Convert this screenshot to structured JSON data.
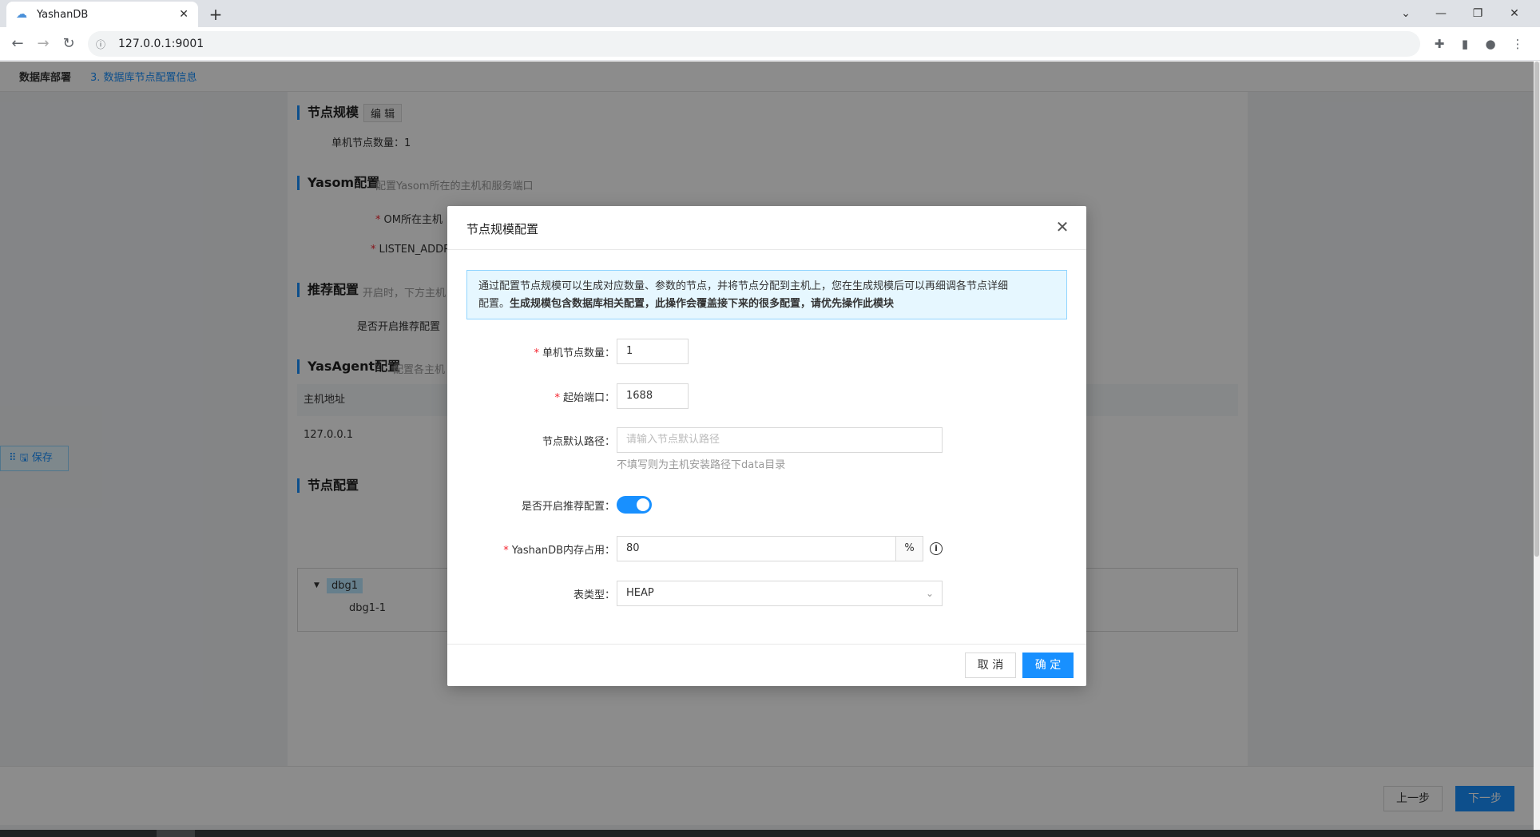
{
  "browser": {
    "tab_title": "YashanDB",
    "url": "127.0.0.1:9001",
    "icons": [
      "favicon-icon",
      "close-icon",
      "plus-icon",
      "back-icon",
      "forward-icon",
      "reload-icon",
      "info-icon",
      "extension-icon",
      "sidepanel-icon",
      "profile-icon",
      "menu-icon"
    ]
  },
  "header": {
    "crumb_main": "数据库部署",
    "crumb_step": "3. 数据库节点配置信息"
  },
  "page": {
    "node_scale": {
      "title": "节点规模",
      "edit_label": "编 辑",
      "count_label": "单机节点数量：1"
    },
    "yasom": {
      "title": "Yasom配置",
      "subtitle": "配置Yasom所在的主机和服务端口",
      "om_host_label": "OM所在主机",
      "listen_label": "LISTEN_ADDR"
    },
    "recommend": {
      "title": "推荐配置",
      "subtitle": "开启时，下方主机",
      "enable_label": "是否开启推荐配置"
    },
    "yasagent": {
      "title": "YasAgent配置",
      "subtitle": "配置各主机",
      "col_host": "主机地址",
      "host_value": "127.0.0.1"
    },
    "node_config": {
      "title": "节点配置",
      "tree_root": "dbg1",
      "tree_child": "dbg1-1"
    },
    "save_label": "保存"
  },
  "footer": {
    "prev_label": "上一步",
    "next_label": "下一步"
  },
  "modal": {
    "title": "节点规模配置",
    "notice_line1": "通过配置节点规模可以生成对应数量、参数的节点，并将节点分配到主机上，您在生成规模后可以再细调各节点详细",
    "notice_line2_prefix": "配置。",
    "notice_line2_bold": "生成规模包含数据库相关配置，此操作会覆盖接下来的很多配置，请优先操作此模块",
    "fields": {
      "node_count": {
        "label": "单机节点数量：",
        "value": "1"
      },
      "start_port": {
        "label": "起始端口：",
        "value": "1688"
      },
      "default_path": {
        "label": "节点默认路径：",
        "placeholder": "请输入节点默认路径",
        "hint": "不填写则为主机安装路径下data目录"
      },
      "recommend": {
        "label": "是否开启推荐配置：",
        "on": true
      },
      "memory": {
        "label": "YashanDB内存占用：",
        "value": "80",
        "unit": "%"
      },
      "table_type": {
        "label": "表类型：",
        "value": "HEAP"
      }
    },
    "cancel_label": "取 消",
    "ok_label": "确 定"
  },
  "colors": {
    "primary": "#1890ff",
    "required": "#f5222d",
    "notice_bg": "#e6f7ff"
  }
}
